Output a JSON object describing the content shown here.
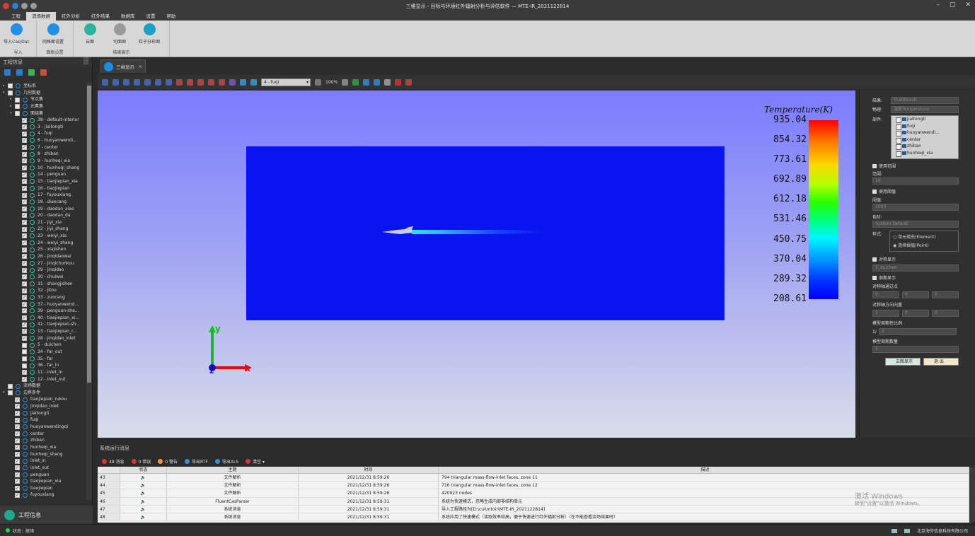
{
  "window": {
    "title": "三维显示 - 目标与环境红外辐射分析与评估软件 — MTE-IR_2021122814",
    "controls": [
      "–",
      "□",
      "✕"
    ]
  },
  "menu": {
    "items": [
      "工程",
      "流场数据",
      "红外分析",
      "红外结果",
      "数据库",
      "设置",
      "帮助"
    ],
    "active_index": 1
  },
  "ribbon": {
    "groups": [
      {
        "label": "导入",
        "buttons": [
          {
            "label": "导入Cas/Dat",
            "icon": "import-cas-dat-icon",
            "color": "#1f8fe8"
          }
        ]
      },
      {
        "label": "面板设置",
        "buttons": [
          {
            "label": "网格面设置",
            "icon": "mesh-face-settings-icon",
            "color": "#1f8fe8"
          }
        ]
      },
      {
        "label": "结果展示",
        "buttons": [
          {
            "label": "云图",
            "icon": "contour-icon",
            "color": "#2cb3a0"
          },
          {
            "label": "切面图",
            "icon": "slice-icon",
            "color": "#9a9a9a"
          },
          {
            "label": "粒子分布图",
            "icon": "particle-distribution-icon",
            "color": "#1aa0c8"
          }
        ]
      }
    ]
  },
  "left_panel": {
    "title": "工程信息",
    "pin": "‹",
    "tree": [
      {
        "label": "坐标系",
        "level": 0,
        "arrow": "▸",
        "icon": "axes"
      },
      {
        "label": "几何数据",
        "level": 0,
        "arrow": "▾",
        "icon": "geo"
      },
      {
        "label": "节点集",
        "level": 1,
        "arrow": "▸",
        "icon": "node"
      },
      {
        "label": "元素集",
        "level": 1,
        "arrow": "▸",
        "icon": "elem"
      },
      {
        "label": "面组集",
        "level": 1,
        "arrow": "▾",
        "icon": "face"
      },
      {
        "label": "38 - default-interior",
        "level": 2,
        "checked": true
      },
      {
        "label": "3 - jiaitongti",
        "level": 2,
        "checked": true
      },
      {
        "label": "4 - fuqi",
        "level": 2,
        "checked": true
      },
      {
        "label": "6 - huoyanwendi...",
        "level": 2,
        "checked": true
      },
      {
        "label": "7 - center",
        "level": 2,
        "checked": true
      },
      {
        "label": "8 - zhiban",
        "level": 2,
        "checked": true
      },
      {
        "label": "9 - hunheqi_xia",
        "level": 2,
        "checked": true
      },
      {
        "label": "10 - hunheqi_shang",
        "level": 2,
        "checked": true
      },
      {
        "label": "14 - penguan",
        "level": 2,
        "checked": true
      },
      {
        "label": "15 - tiaojiepian_xia",
        "level": 2,
        "checked": true
      },
      {
        "label": "16 - tiaojiepian",
        "level": 2,
        "checked": true
      },
      {
        "label": "17 - fuyouxiang",
        "level": 2,
        "checked": true
      },
      {
        "label": "18 - diaocang",
        "level": 2,
        "checked": true
      },
      {
        "label": "19 - daodan_xiao",
        "level": 2,
        "checked": true
      },
      {
        "label": "20 - daodan_da",
        "level": 2,
        "checked": true
      },
      {
        "label": "21 - jiyi_xia",
        "level": 2,
        "checked": true
      },
      {
        "label": "22 - jiyi_shang",
        "level": 2,
        "checked": true
      },
      {
        "label": "23 - weiyi_xia",
        "level": 2,
        "checked": true
      },
      {
        "label": "24 - weiyi_shang",
        "level": 2,
        "checked": true
      },
      {
        "label": "25 - xiajishen",
        "level": 2,
        "checked": true
      },
      {
        "label": "26 - jinqidaowai",
        "level": 2,
        "checked": true
      },
      {
        "label": "27 - jinqichunkou",
        "level": 2,
        "checked": true
      },
      {
        "label": "29 - jinqidao",
        "level": 2,
        "checked": true
      },
      {
        "label": "30 - chuiwei",
        "level": 2,
        "checked": true
      },
      {
        "label": "31 - shangjishen",
        "level": 2,
        "checked": true
      },
      {
        "label": "32 - jitou",
        "level": 2,
        "checked": true
      },
      {
        "label": "33 - zuocang",
        "level": 2,
        "checked": true
      },
      {
        "label": "37 - huoyanwend...",
        "level": 2,
        "checked": true
      },
      {
        "label": "39 - penguan-sha...",
        "level": 2,
        "checked": true
      },
      {
        "label": "40 - tiaojiepian_xi...",
        "level": 2,
        "checked": true
      },
      {
        "label": "41 - tiaojiepian-sh...",
        "level": 2,
        "checked": true
      },
      {
        "label": "13 - tiaojiepian_r...",
        "level": 2,
        "checked": true
      },
      {
        "label": "28 - jinqidao_inlet",
        "level": 2,
        "checked": true
      },
      {
        "label": "5 - duichen",
        "level": 2,
        "checked": false
      },
      {
        "label": "34 - far_out",
        "level": 2,
        "checked": false
      },
      {
        "label": "35 - far",
        "level": 2,
        "checked": false
      },
      {
        "label": "36 - far_in",
        "level": 2,
        "checked": false
      },
      {
        "label": "11 - inlet_in",
        "level": 2,
        "checked": true
      },
      {
        "label": "12 - inlet_out",
        "level": 2,
        "checked": true
      },
      {
        "label": "流场数据",
        "level": 0,
        "arrow": "",
        "icon": "flow"
      },
      {
        "label": "边界条件",
        "level": 0,
        "arrow": "▾",
        "icon": "bc"
      },
      {
        "label": "tiaojiepian_rukou",
        "level": 1,
        "checked": true,
        "bc": true
      },
      {
        "label": "jinqidao_inlet",
        "level": 1,
        "checked": true,
        "bc": true
      },
      {
        "label": "jiaitongti",
        "level": 1,
        "checked": true,
        "bc": true
      },
      {
        "label": "fuqi",
        "level": 1,
        "checked": true,
        "bc": true
      },
      {
        "label": "huoyanwendingqi",
        "level": 1,
        "checked": true,
        "bc": true
      },
      {
        "label": "center",
        "level": 1,
        "checked": true,
        "bc": true
      },
      {
        "label": "zhiban",
        "level": 1,
        "checked": true,
        "bc": true
      },
      {
        "label": "hunheqi_xia",
        "level": 1,
        "checked": true,
        "bc": true
      },
      {
        "label": "hunheqi_shang",
        "level": 1,
        "checked": true,
        "bc": true
      },
      {
        "label": "inlet_in",
        "level": 1,
        "checked": true,
        "bc": true
      },
      {
        "label": "inlet_out",
        "level": 1,
        "checked": true,
        "bc": true
      },
      {
        "label": "penguan",
        "level": 1,
        "checked": true,
        "bc": true
      },
      {
        "label": "tiaojiepian_xia",
        "level": 1,
        "checked": true,
        "bc": true
      },
      {
        "label": "tiaojiepian",
        "level": 1,
        "checked": true,
        "bc": true
      },
      {
        "label": "fuyouxiang",
        "level": 1,
        "checked": true,
        "bc": true
      }
    ],
    "footer_label": "工程信息"
  },
  "doc_tab": {
    "label": "三维显示",
    "close": "×"
  },
  "view_toolbar": {
    "part_select": "4 - fuqi",
    "zoom": "100%"
  },
  "viewport": {
    "legend_title": "Temperature(K)",
    "ticks": [
      "935.04",
      "854.32",
      "773.61",
      "692.89",
      "612.18",
      "531.46",
      "450.75",
      "370.04",
      "289.32",
      "208.61"
    ],
    "axis_labels": {
      "x": "x",
      "y": "y",
      "z": "z"
    }
  },
  "properties": {
    "rows": [
      {
        "label": "结果:",
        "value": "FluidResult"
      },
      {
        "label": "物理:",
        "value": "温度Temperature"
      },
      {
        "label": "部件:",
        "value": ""
      }
    ],
    "parts": [
      "jiaitongti",
      "fuqi",
      "huoyanwendi...",
      "center",
      "zhiban",
      "hunheqi_xia"
    ],
    "use_range": "使用范围",
    "range_label": "范围:",
    "range_value": "10",
    "use_threshold": "使用阈值",
    "threshold_label": "阈值:",
    "threshold_value": "1000",
    "color_label": "色阶:",
    "color_value": "System Default",
    "style_label": "样式:",
    "style_options": [
      "单元填充(Element)",
      "连续插值(Point)"
    ],
    "symmetry": "对称显示",
    "symmetry_value": "5_duichen",
    "period": "周期显示",
    "sym_center": "对称轴通过点",
    "sym_center_vals": [
      "0",
      "0",
      "0"
    ],
    "sym_dir": "对称轴方向向量",
    "sym_dir_vals": [
      "1",
      "0",
      "0"
    ],
    "period_ratio": "模型周期性比例",
    "period_ratio_prefix": "1/",
    "period_ratio_val": "2",
    "period_count": "模型周期数量",
    "period_count_val": "2",
    "btn_show": "云图显示",
    "btn_exit": "退 出"
  },
  "messages": {
    "title": "系统运行消息",
    "toolbar": [
      {
        "label": "48 消息",
        "color": "#d33"
      },
      {
        "label": "0 错误",
        "color": "#d33"
      },
      {
        "label": "0 警告",
        "color": "#e93"
      },
      {
        "label": "导出RTF",
        "color": "#3a8ed8"
      },
      {
        "label": "导出XLS",
        "color": "#3a8ed8"
      },
      {
        "label": "清空 ▾",
        "color": "#d33"
      }
    ],
    "headers": [
      "",
      "状态",
      "主题",
      "时间",
      "描述"
    ],
    "rows": [
      [
        "43",
        "🔈",
        "文件解析",
        "2021/12/31 8:59:26",
        "794 triangular mass-flow-inlet faces, zone 11"
      ],
      [
        "44",
        "🔈",
        "文件解析",
        "2021/12/31 8:59:26",
        "716 triangular mass-flow-inlet faces, zone 12"
      ],
      [
        "45",
        "🔈",
        "文件解析",
        "2021/12/31 8:59:26",
        "420923 nodes"
      ],
      [
        "46",
        "🔈",
        "FluentCasParser",
        "2021/12/31 8:59:31",
        "系统为快速模式，忽略生成内部非结构单元"
      ],
      [
        "47",
        "🔈",
        "系统消息",
        "2021/12/31 8:59:31",
        "导入工程路径为[D:\\cui\\mtoir\\MTE-IR_2021122814]"
      ],
      [
        "48",
        "🔈",
        "系统消息",
        "2021/12/31 8:59:31",
        "系统应用了快速模式（读取效率较高，便于快速进行红外辐射分析）（在不能查看流场结果时）"
      ]
    ]
  },
  "watermark": {
    "line1": "激活 Windows",
    "line2": "转到\"设置\"以激活 Windows。"
  },
  "status": {
    "text": "状态：就绪",
    "company": "北京海芬信息科技有限公司"
  }
}
